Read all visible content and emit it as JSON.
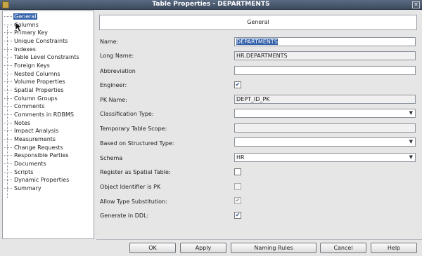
{
  "window": {
    "title": "Table Properties - DEPARTMENTS",
    "close_glyph": "×"
  },
  "tree": {
    "items": [
      {
        "label": "General",
        "selected": true
      },
      {
        "label": "Columns"
      },
      {
        "label": "Primary Key"
      },
      {
        "label": "Unique Constraints"
      },
      {
        "label": "Indexes"
      },
      {
        "label": "Table Level Constraints"
      },
      {
        "label": "Foreign Keys"
      },
      {
        "label": "Nested Columns"
      },
      {
        "label": "Volume Properties"
      },
      {
        "label": "Spatial Properties"
      },
      {
        "label": "Column Groups"
      },
      {
        "label": "Comments"
      },
      {
        "label": "Comments in RDBMS"
      },
      {
        "label": "Notes"
      },
      {
        "label": "Impact Analysis"
      },
      {
        "label": "Measurements"
      },
      {
        "label": "Change Requests"
      },
      {
        "label": "Responsible Parties"
      },
      {
        "label": "Documents"
      },
      {
        "label": "Scripts"
      },
      {
        "label": "Dynamic Properties"
      },
      {
        "label": "Summary"
      }
    ]
  },
  "form": {
    "header": "General",
    "name_label": "Name:",
    "name_value": "DEPARTMENTS",
    "long_name_label": "Long Name:",
    "long_name_value": "HR.DEPARTMENTS",
    "abbreviation_label": "Abbreviation",
    "abbreviation_value": "",
    "engineer_label": "Engineer:",
    "engineer_checked": true,
    "pk_name_label": "PK Name:",
    "pk_name_value": "DEPT_ID_PK",
    "classification_label": "Classification Type:",
    "classification_value": "",
    "temp_scope_label": "Temporary Table Scope:",
    "temp_scope_value": "",
    "structured_type_label": "Based on Structured Type:",
    "structured_type_value": "",
    "schema_label": "Schema",
    "schema_value": "HR",
    "spatial_label": "Register as Spatial Table:",
    "spatial_checked": false,
    "oid_label": "Object Identifier is PK",
    "oid_checked": false,
    "allow_sub_label": "Allow Type Substitution:",
    "allow_sub_checked": true,
    "generate_ddl_label": "Generate in DDL:",
    "generate_ddl_checked": true,
    "check_glyph": "✔",
    "dropdown_glyph": "▼"
  },
  "buttons": {
    "ok": "OK",
    "apply": "Apply",
    "naming_rules": "Naming Rules",
    "cancel": "Cancel",
    "help": "Help"
  }
}
